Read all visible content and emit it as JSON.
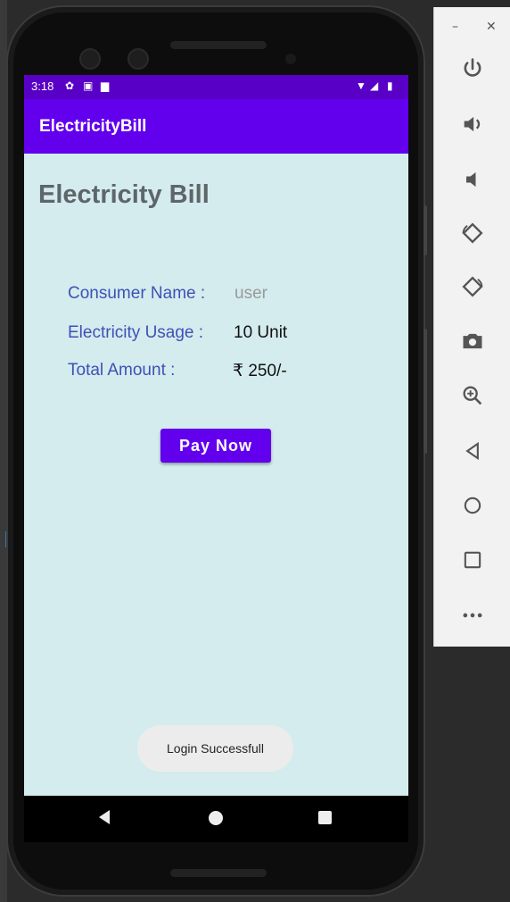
{
  "status_bar": {
    "time": "3:18"
  },
  "app_bar": {
    "title": "ElectricityBill"
  },
  "main": {
    "heading": "Electricity Bill",
    "fields": [
      {
        "label": "Consumer Name :",
        "value": "user"
      },
      {
        "label": "Electricity Usage :",
        "value": "10 Unit"
      },
      {
        "label": "Total Amount :",
        "value": "₹ 250/-"
      }
    ],
    "pay_button_label": "Pay Now"
  },
  "toast": {
    "message": "Login Successfull"
  },
  "emulator_toolbar": {
    "buttons": [
      "power-icon",
      "volume-up-icon",
      "volume-down-icon",
      "rotate-left-icon",
      "rotate-right-icon",
      "camera-icon",
      "zoom-icon",
      "back-icon",
      "home-icon",
      "overview-icon",
      "more-icon"
    ]
  },
  "colors": {
    "app_bar": "#6200ee",
    "status_bar": "#5900c6",
    "screen_bg": "#d4ecee",
    "label": "#3f51b5"
  }
}
